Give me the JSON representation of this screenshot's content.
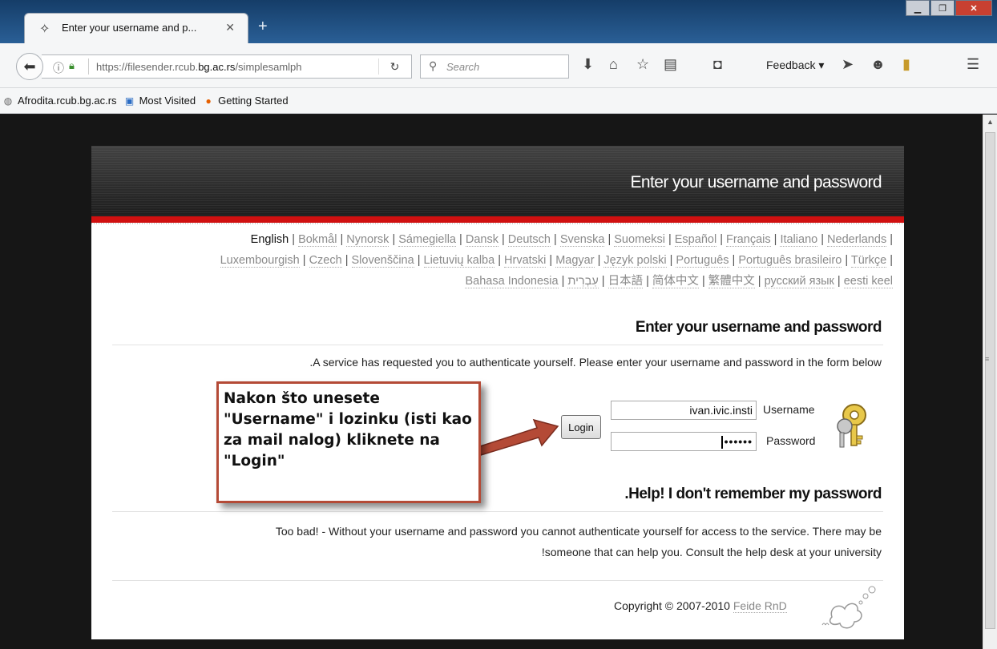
{
  "browser": {
    "tab_title": "Enter your username and p...",
    "tab_close": "✕",
    "new_tab": "+",
    "url_prefix": "https://filesender.rcub.",
    "url_domain": "bg.ac.rs",
    "url_suffix": "/simplesamlph",
    "search_placeholder": "Search",
    "feedback_label": "Feedback",
    "bookmarks": [
      "Afrodita.rcub.bg.ac.rs",
      "Most Visited",
      "Getting Started"
    ]
  },
  "page": {
    "header_title": "Enter your username and password",
    "languages": [
      [
        "English",
        "Bokmål",
        "Nynorsk",
        "Sámegiella",
        "Dansk",
        "Deutsch",
        "Svenska",
        "Suomeksi",
        "Español",
        "Français",
        "Italiano",
        "Nederlands"
      ],
      [
        "Luxembourgish",
        "Czech",
        "Slovenščina",
        "Lietuvių kalba",
        "Hrvatski",
        "Magyar",
        "Język polski",
        "Português",
        "Português brasileiro",
        "Türkçe"
      ],
      [
        "Bahasa Indonesia",
        "עִבְרִית",
        "日本語",
        "简体中文",
        "繁體中文",
        "русский язык",
        "eesti keel"
      ]
    ],
    "current_language": "English",
    "login_heading": "Enter your username and password",
    "login_intro": ".A service has requested you to authenticate yourself. Please enter your username and password in the form below",
    "login_button": "Login",
    "username_value": "ivan.ivic.insti",
    "username_label": "Username",
    "password_mask": "••••••",
    "password_label": "Password",
    "help_heading": ".Help! I don't remember my password",
    "help_line1": "Too bad! - Without your username and password you cannot authenticate yourself for access to the service. There may be",
    "help_line2": "!someone that can help you. Consult the help desk at your university",
    "copyright_text": "Copyright © 2007-2010",
    "copyright_link": "Feide RnD"
  },
  "annotation": {
    "callout_text": "Nakon što unesete \"Username\" i lozinku (isti kao za mail nalog) kliknete na \"Login\"",
    "border_color": "#b44a36"
  }
}
